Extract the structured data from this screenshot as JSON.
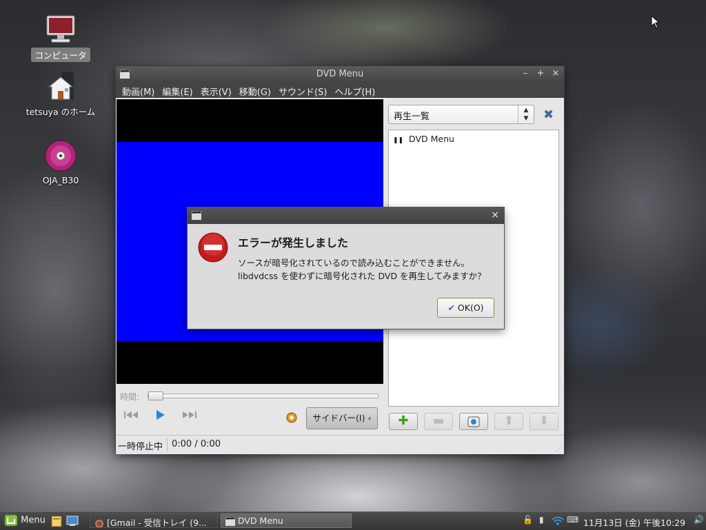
{
  "desktop": {
    "icons": [
      {
        "label": "コンピュータ"
      },
      {
        "label": "tetsuya のホーム"
      },
      {
        "label": "OJA_B30"
      }
    ]
  },
  "window": {
    "title": "DVD Menu",
    "controls": {
      "minimize": "–",
      "maximize": "+",
      "close": "×"
    },
    "menu": [
      "動画(M)",
      "編集(E)",
      "表示(V)",
      "移動(G)",
      "サウンド(S)",
      "ヘルプ(H)"
    ],
    "seek_label": "時間:",
    "sidebar_button": "サイドバー(I)",
    "sidebar_arrow": "‹",
    "status": {
      "state": "一時停止中",
      "time": "0:00 / 0:00"
    },
    "playlist": {
      "combo_value": "再生一覧",
      "items": [
        "DVD Menu"
      ]
    },
    "colors": {
      "video_bg": "#0000ff",
      "accent": "#2a86d8"
    }
  },
  "dialog": {
    "heading": "エラーが発生しました",
    "message_line1": "ソースが暗号化されているので読み込むことができません。",
    "message_line2": "libdvdcss を使わずに暗号化された DVD を再生してみますか？",
    "ok_label": "OK(O)",
    "close": "×"
  },
  "taskbar": {
    "menu_label": "Menu",
    "tasks": [
      {
        "label": "[Gmail - 受信トレイ (9..."
      },
      {
        "label": "DVD Menu"
      }
    ],
    "clock": "11月13日 (金) 午後10:29"
  }
}
